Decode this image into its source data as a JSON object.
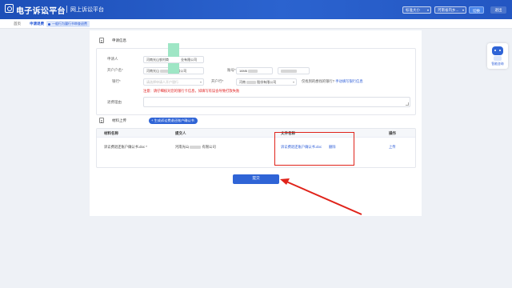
{
  "header": {
    "app_title": "电子诉讼平台",
    "app_subtitle": "网上诉讼平台",
    "font_size_label": "标准大小",
    "court_select": "河南省内乡...",
    "switch_button": "切换",
    "logout_button": "退出",
    "brand_color": "#1d4fb8"
  },
  "breadcrumb": {
    "home": "首页",
    "current": "申请退费",
    "tag": "一般行为履行书审查退费"
  },
  "apply_info": {
    "section_title": "申请信息",
    "applicant_label": "申请人",
    "applicant_value": "河南光山农村商",
    "applicant_value_suffix": "业有限公司",
    "account_name_label": "开户户名*",
    "account_name_value": "河南光山",
    "account_name_value2": "业有限公司",
    "account_no_label": "账号*",
    "account_no_value": "16M6",
    "bank_label": "银行*",
    "bank_placeholder": "请选择申请人开户银行",
    "branch_label": "开户行*",
    "branch_value": "河南",
    "branch_value2": "股份有限公司",
    "hint_text": "仅找到的想找的银行?",
    "hint_link": "手动填写银行信息",
    "warning": "注意：请仔细核对您的银行卡信息，如填写有误会导致打款失败",
    "reason_label": "退费理由"
  },
  "materials": {
    "section_title": "材料上传",
    "generate_button": "+ 生成诉讼费退还账户确认书",
    "columns": [
      "材料名称",
      "提交人",
      "文件名称",
      "操作"
    ],
    "rows": [
      {
        "name": "诉讼费退还账户确认书.doc *",
        "submitter": "河南光山",
        "submitter_suffix": "有限公司",
        "file": "诉讼费退还账户确认书.doc",
        "delete": "删除",
        "action": "上传"
      }
    ]
  },
  "submit_button": "提交",
  "robot": {
    "label": "智能咨询"
  },
  "colors": {
    "accent": "#2f64d6",
    "highlight": "#e0231a",
    "warning": "#e02020",
    "green_block": "#9ee6c5"
  }
}
